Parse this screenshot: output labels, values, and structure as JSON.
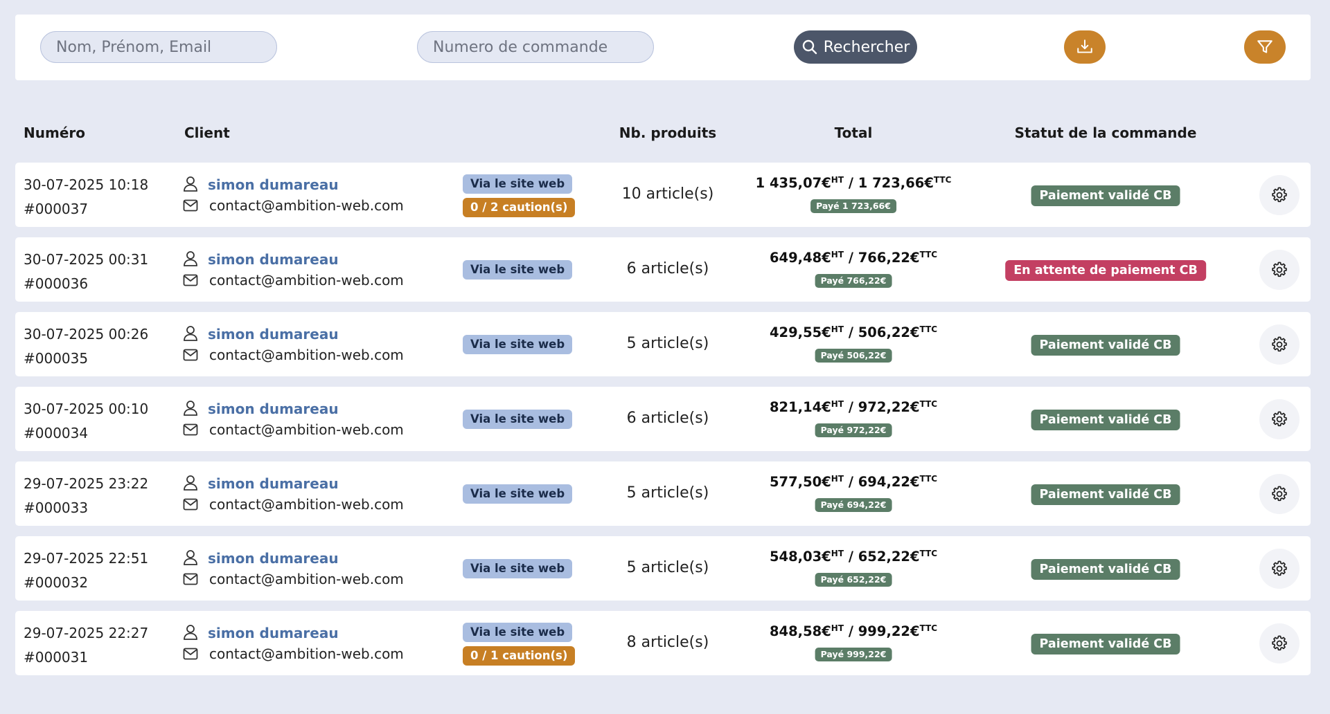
{
  "search": {
    "name_placeholder": "Nom, Prénom, Email",
    "order_placeholder": "Numero de commande",
    "search_label": "Rechercher"
  },
  "icons": {
    "search": "search-icon",
    "download": "download-icon",
    "filter": "filter-icon",
    "user": "user-icon",
    "mail": "mail-icon",
    "settings": "gear-icon"
  },
  "colors": {
    "background": "#e6e9f3",
    "accent_orange": "#c9832a",
    "search_button": "#4c5669",
    "client_link": "#4a6fa5",
    "status_ok": "#5b7d67",
    "status_pending": "#c33f62",
    "tag_web": "#a9bde0"
  },
  "headers": {
    "numero": "Numéro",
    "client": "Client",
    "products": "Nb. produits",
    "total": "Total",
    "status": "Statut de la commande"
  },
  "orders": [
    {
      "date": "30-07-2025 10:18",
      "number": "#000037",
      "client_name": "simon dumareau",
      "client_email": "contact@ambition-web.com",
      "tags": [
        "Via le site web",
        "0 / 2 caution(s)"
      ],
      "products": "10 article(s)",
      "total_ht": "1 435,07€",
      "ht": "HT",
      "total_sep": " / ",
      "total_ttc": "1 723,66€",
      "ttc": "TTC",
      "paid": "Payé 1 723,66€",
      "status": "Paiement validé CB",
      "status_type": "ok"
    },
    {
      "date": "30-07-2025 00:31",
      "number": "#000036",
      "client_name": "simon dumareau",
      "client_email": "contact@ambition-web.com",
      "tags": [
        "Via le site web"
      ],
      "products": "6 article(s)",
      "total_ht": "649,48€",
      "ht": "HT",
      "total_sep": " / ",
      "total_ttc": "766,22€",
      "ttc": "TTC",
      "paid": "Payé 766,22€",
      "status": "En attente de paiement CB",
      "status_type": "pending"
    },
    {
      "date": "30-07-2025 00:26",
      "number": "#000035",
      "client_name": "simon dumareau",
      "client_email": "contact@ambition-web.com",
      "tags": [
        "Via le site web"
      ],
      "products": "5 article(s)",
      "total_ht": "429,55€",
      "ht": "HT",
      "total_sep": " / ",
      "total_ttc": "506,22€",
      "ttc": "TTC",
      "paid": "Payé 506,22€",
      "status": "Paiement validé CB",
      "status_type": "ok"
    },
    {
      "date": "30-07-2025 00:10",
      "number": "#000034",
      "client_name": "simon dumareau",
      "client_email": "contact@ambition-web.com",
      "tags": [
        "Via le site web"
      ],
      "products": "6 article(s)",
      "total_ht": "821,14€",
      "ht": "HT",
      "total_sep": " / ",
      "total_ttc": "972,22€",
      "ttc": "TTC",
      "paid": "Payé 972,22€",
      "status": "Paiement validé CB",
      "status_type": "ok"
    },
    {
      "date": "29-07-2025 23:22",
      "number": "#000033",
      "client_name": "simon dumareau",
      "client_email": "contact@ambition-web.com",
      "tags": [
        "Via le site web"
      ],
      "products": "5 article(s)",
      "total_ht": "577,50€",
      "ht": "HT",
      "total_sep": " / ",
      "total_ttc": "694,22€",
      "ttc": "TTC",
      "paid": "Payé 694,22€",
      "status": "Paiement validé CB",
      "status_type": "ok"
    },
    {
      "date": "29-07-2025 22:51",
      "number": "#000032",
      "client_name": "simon dumareau",
      "client_email": "contact@ambition-web.com",
      "tags": [
        "Via le site web"
      ],
      "products": "5 article(s)",
      "total_ht": "548,03€",
      "ht": "HT",
      "total_sep": " / ",
      "total_ttc": "652,22€",
      "ttc": "TTC",
      "paid": "Payé 652,22€",
      "status": "Paiement validé CB",
      "status_type": "ok"
    },
    {
      "date": "29-07-2025 22:27",
      "number": "#000031",
      "client_name": "simon dumareau",
      "client_email": "contact@ambition-web.com",
      "tags": [
        "Via le site web",
        "0 / 1 caution(s)"
      ],
      "products": "8 article(s)",
      "total_ht": "848,58€",
      "ht": "HT",
      "total_sep": " / ",
      "total_ttc": "999,22€",
      "ttc": "TTC",
      "paid": "Payé 999,22€",
      "status": "Paiement validé CB",
      "status_type": "ok"
    }
  ]
}
